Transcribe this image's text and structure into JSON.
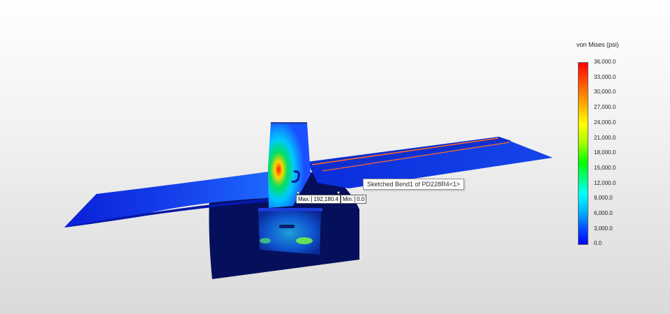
{
  "legend": {
    "title": "von Mises (psi)",
    "ticks": [
      "36,000.0",
      "33,000.0",
      "30,000.0",
      "27,000.0",
      "24,000.0",
      "21,000.0",
      "18,000.0",
      "15,000.0",
      "12,000.0",
      "9,000.0",
      "6,000.0",
      "3,000.0",
      "0.0"
    ]
  },
  "tooltip": {
    "text": "Sketched Bend1 of PD228R4<1>"
  },
  "probes": {
    "max_label": "Max:",
    "max_value": "192,180.4",
    "min_label": "Min:",
    "min_value": "0.0"
  },
  "colors": {
    "background_top": "#ffffff",
    "background_bottom": "#dadada",
    "stress_low": "#0000ff",
    "stress_high": "#ff0000",
    "edge_highlight": "#ff6a1f"
  }
}
